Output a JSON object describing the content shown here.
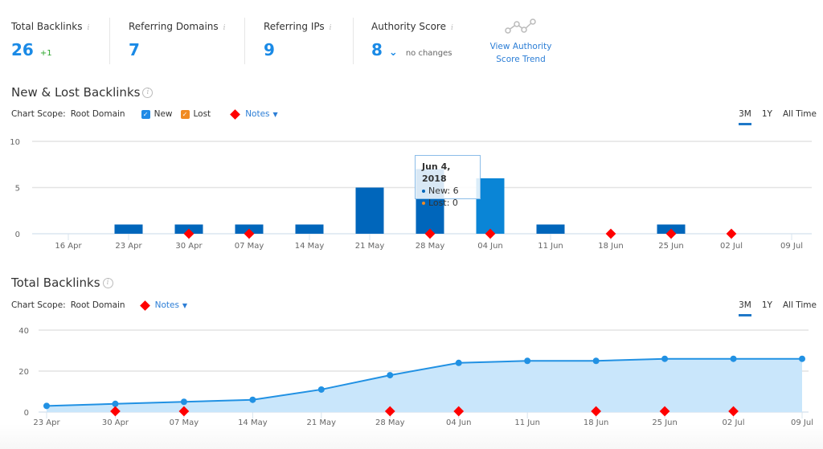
{
  "summary": {
    "metrics": [
      {
        "label": "Total Backlinks",
        "value": "26",
        "delta": "+1"
      },
      {
        "label": "Referring Domains",
        "value": "7"
      },
      {
        "label": "Referring IPs",
        "value": "9"
      },
      {
        "label": "Authority Score",
        "value": "8",
        "status": "no changes"
      }
    ],
    "info_glyph": "i",
    "trend_link": {
      "line1": "View Authority",
      "line2": "Score Trend",
      "icon": "trend-line-icon"
    }
  },
  "new_lost": {
    "title": "New & Lost Backlinks",
    "scope_label": "Chart Scope:",
    "scope_value": "Root Domain",
    "legend_new": "New",
    "legend_lost": "Lost",
    "notes_label": "Notes",
    "ranges": [
      "3M",
      "1Y",
      "All Time"
    ],
    "active_range": "3M",
    "tooltip": {
      "date": "Jun 4, 2018",
      "new": "New: 6",
      "lost": "Lost: 0"
    }
  },
  "total": {
    "title": "Total Backlinks",
    "scope_label": "Chart Scope:",
    "scope_value": "Root Domain",
    "notes_label": "Notes",
    "ranges": [
      "3M",
      "1Y",
      "All Time"
    ],
    "active_range": "3M"
  },
  "colors": {
    "accent": "#1a8ae6",
    "bar": "#0066bb",
    "bar_highlight": "#0a85d6",
    "note": "#ff0000",
    "area": "#c9e6fb",
    "line": "#2191e3",
    "lost": "#f08a22"
  },
  "chart_data": [
    {
      "type": "bar",
      "title": "New & Lost Backlinks",
      "categories": [
        "16 Apr",
        "23 Apr",
        "30 Apr",
        "07 May",
        "14 May",
        "21 May",
        "28 May",
        "04 Jun",
        "11 Jun",
        "18 Jun",
        "25 Jun",
        "02 Jul",
        "09 Jul"
      ],
      "series": [
        {
          "name": "New",
          "values": [
            0,
            1,
            1,
            1,
            1,
            5,
            7,
            6,
            1,
            0,
            1,
            0,
            0
          ]
        },
        {
          "name": "Lost",
          "values": [
            0,
            0,
            0,
            0,
            0,
            0,
            0,
            0,
            0,
            0,
            0,
            0,
            0
          ]
        }
      ],
      "notes_at": [
        "30 Apr",
        "07 May",
        "28 May",
        "04 Jun",
        "18 Jun",
        "25 Jun",
        "02 Jul"
      ],
      "highlighted": "04 Jun",
      "yticks": [
        0,
        5,
        10
      ],
      "ylim": [
        0,
        10
      ],
      "grid": true
    },
    {
      "type": "area",
      "title": "Total Backlinks",
      "categories": [
        "23 Apr",
        "30 Apr",
        "07 May",
        "14 May",
        "21 May",
        "28 May",
        "04 Jun",
        "11 Jun",
        "18 Jun",
        "25 Jun",
        "02 Jul",
        "09 Jul"
      ],
      "series": [
        {
          "name": "Total Backlinks",
          "values": [
            3,
            4,
            5,
            6,
            11,
            18,
            24,
            25,
            25,
            26,
            26,
            26
          ]
        }
      ],
      "notes_at": [
        "30 Apr",
        "07 May",
        "28 May",
        "04 Jun",
        "18 Jun",
        "25 Jun",
        "02 Jul"
      ],
      "yticks": [
        0,
        20,
        40
      ],
      "ylim": [
        0,
        40
      ],
      "grid": true
    }
  ]
}
